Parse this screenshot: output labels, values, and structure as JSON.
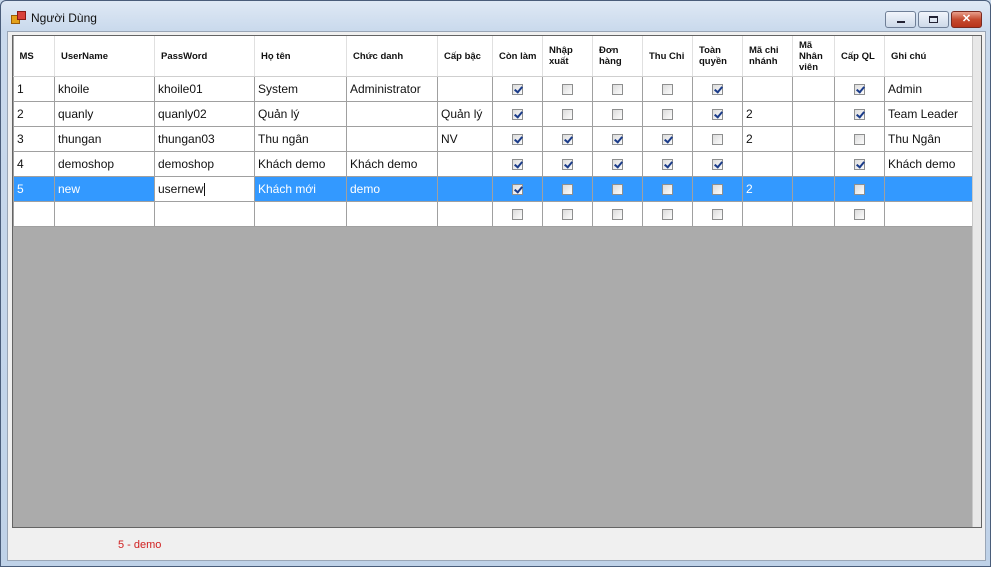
{
  "window": {
    "title": "Người Dùng"
  },
  "columns": [
    "MS",
    "UserName",
    "PassWord",
    "Họ tên",
    "Chức danh",
    "Cấp bậc",
    "Còn làm",
    "Nhập xuất",
    "Đơn hàng",
    "Thu Chi",
    "Toàn quyền",
    "Mã chi nhánh",
    "Mã Nhân viên",
    "Cấp QL",
    "Ghi chú"
  ],
  "rows": [
    {
      "ms": "1",
      "username": "khoile",
      "password": "khoile01",
      "hoten": "System",
      "chucdanh": "Administrator",
      "capbac": "",
      "conlam": true,
      "nhapxuat": false,
      "donhang": false,
      "thuchi": false,
      "toanquyen": true,
      "machinhanh": "",
      "manhanvien": "",
      "capql": true,
      "ghichu": "Admin"
    },
    {
      "ms": "2",
      "username": "quanly",
      "password": "quanly02",
      "hoten": "Quản lý",
      "chucdanh": "",
      "capbac": "Quản lý",
      "conlam": true,
      "nhapxuat": false,
      "donhang": false,
      "thuchi": false,
      "toanquyen": true,
      "machinhanh": "2",
      "manhanvien": "",
      "capql": true,
      "ghichu": "Team Leader"
    },
    {
      "ms": "3",
      "username": "thungan",
      "password": "thungan03",
      "hoten": "Thu ngân",
      "chucdanh": "",
      "capbac": "NV",
      "conlam": true,
      "nhapxuat": true,
      "donhang": true,
      "thuchi": true,
      "toanquyen": false,
      "machinhanh": "2",
      "manhanvien": "",
      "capql": false,
      "ghichu": "Thu Ngân"
    },
    {
      "ms": "4",
      "username": "demoshop",
      "password": "demoshop",
      "hoten": "Khách demo",
      "chucdanh": "Khách demo",
      "capbac": "",
      "conlam": true,
      "nhapxuat": true,
      "donhang": true,
      "thuchi": true,
      "toanquyen": true,
      "machinhanh": "",
      "manhanvien": "",
      "capql": true,
      "ghichu": "Khách demo"
    },
    {
      "ms": "5",
      "username": "new",
      "password": "usernew",
      "hoten": "Khách mới",
      "chucdanh": "demo",
      "capbac": "",
      "conlam": true,
      "nhapxuat": false,
      "donhang": false,
      "thuchi": false,
      "toanquyen": false,
      "machinhanh": "2",
      "manhanvien": "",
      "capql": false,
      "ghichu": "",
      "selected": true
    },
    {
      "ms": "",
      "username": "",
      "password": "",
      "hoten": "",
      "chucdanh": "",
      "capbac": "",
      "conlam": false,
      "nhapxuat": false,
      "donhang": false,
      "thuchi": false,
      "toanquyen": false,
      "machinhanh": "",
      "manhanvien": "",
      "capql": false,
      "ghichu": "",
      "newrow": true
    }
  ],
  "status": {
    "text": "5 - demo",
    "color": "#d02020"
  },
  "colors": {
    "selection": "#3399ff",
    "grid_background": "#ababab"
  }
}
